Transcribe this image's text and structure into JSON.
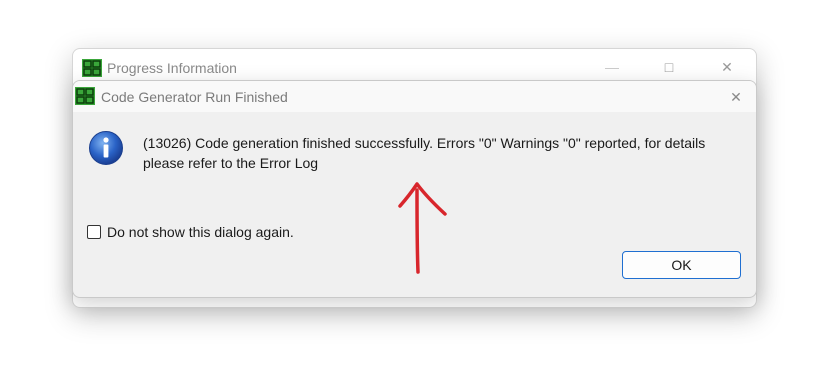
{
  "background_window": {
    "title": "Progress Information",
    "minimize_glyph": "—",
    "maximize_glyph": "□",
    "close_glyph": "✕"
  },
  "dialog": {
    "title": "Code Generator Run Finished",
    "close_glyph": "✕",
    "message": "(13026) Code generation finished successfully. Errors \"0\" Warnings \"0\" reported, for details please refer to the Error Log",
    "checkbox_label": "Do not show this dialog again.",
    "checkbox_checked": false,
    "ok_label": "OK"
  },
  "icons": {
    "app_icon": "app-logo-icon",
    "info_icon": "information-icon",
    "annotation": "red-arrow-annotation"
  },
  "colors": {
    "accent": "#1f6fd1",
    "annotation": "#d8262c",
    "app_icon_fill": "#2ea52e"
  }
}
